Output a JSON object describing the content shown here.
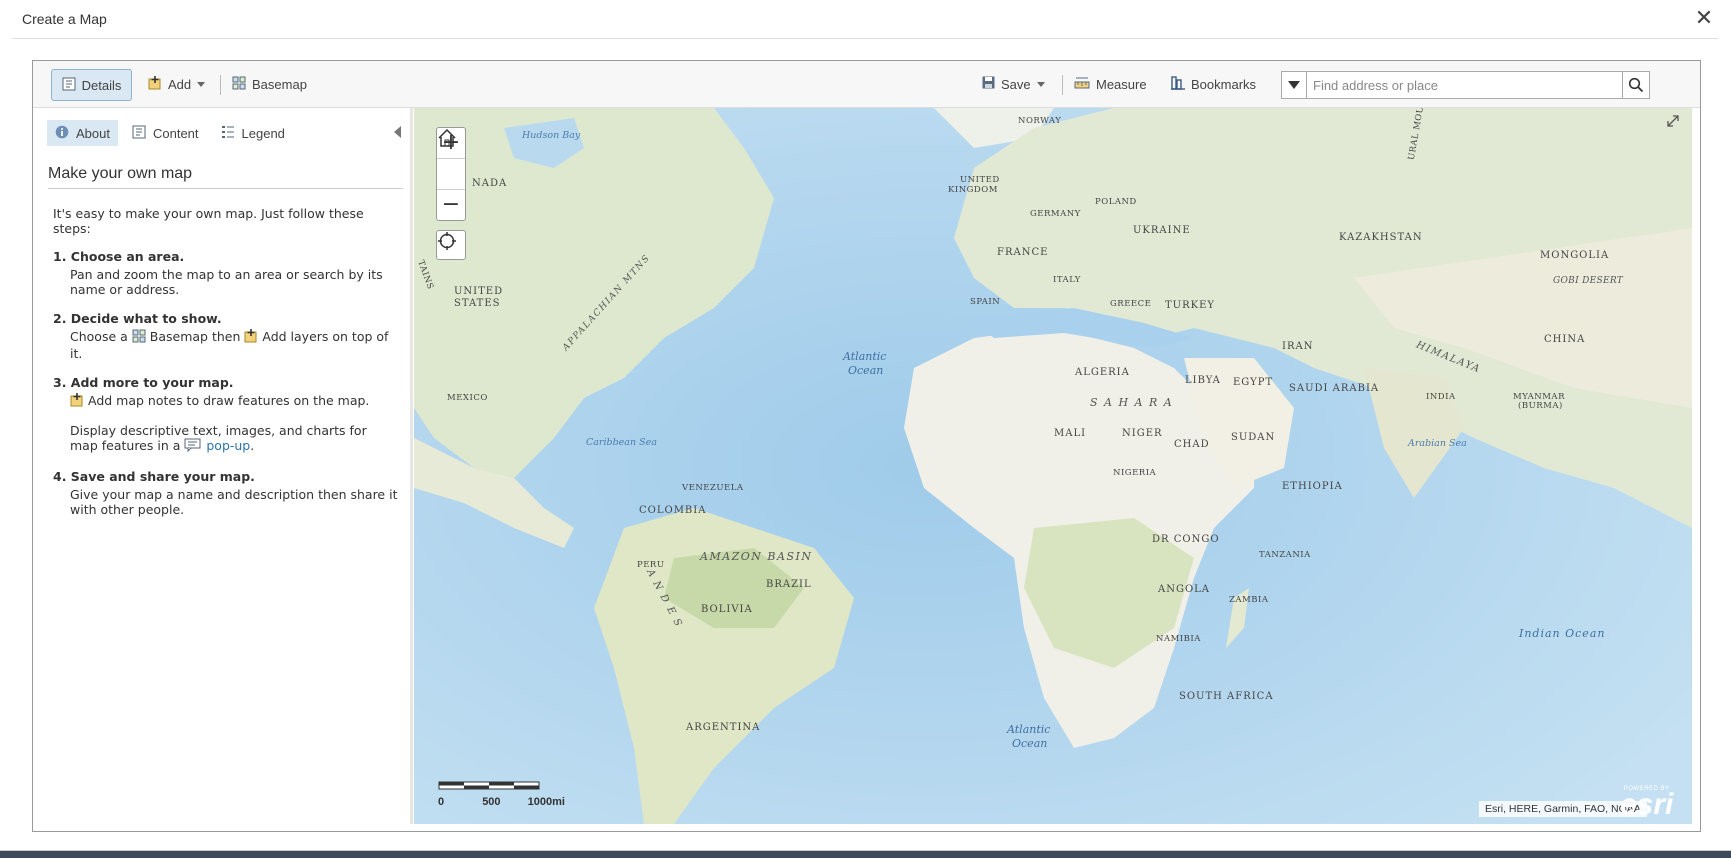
{
  "dialog": {
    "title": "Create a Map",
    "close_glyph": "✕"
  },
  "toolbar": {
    "details_label": "Details",
    "add_label": "Add",
    "basemap_label": "Basemap",
    "save_label": "Save",
    "measure_label": "Measure",
    "bookmarks_label": "Bookmarks"
  },
  "search": {
    "placeholder": "Find address or place",
    "value": ""
  },
  "sidebar": {
    "tabs": [
      {
        "label": "About",
        "icon": "info-icon",
        "active": true
      },
      {
        "label": "Content",
        "icon": "content-icon",
        "active": false
      },
      {
        "label": "Legend",
        "icon": "legend-icon",
        "active": false
      }
    ],
    "about": {
      "title": "Make your own map",
      "intro": "It's easy to make your own map. Just follow these steps:",
      "steps": [
        {
          "head": "1. Choose an area.",
          "text": "Pan and zoom the map to an area or search by its name or address."
        },
        {
          "head": "2. Decide what to show.",
          "text_a": "Choose a",
          "text_b": "Basemap then",
          "text_c": "Add layers on top of it."
        },
        {
          "head": "3. Add more to your map.",
          "text": "Add map notes to draw features on the map.",
          "text2_a": "Display descriptive text, images, and charts for map features in a",
          "link": "pop-up",
          "text2_end": "."
        },
        {
          "head": "4. Save and share your map.",
          "text": "Give your map a name and description then share it with other people."
        }
      ]
    }
  },
  "map": {
    "zoom_in": "+",
    "zoom_out": "−",
    "scale": {
      "zero": "0",
      "mid": "500",
      "end": "1000mi"
    },
    "attribution": "Esri, HERE, Garmin, FAO, NOAA",
    "logo": {
      "powered": "POWERED BY",
      "brand": "esri"
    },
    "labels": {
      "hudson_bay": "Hudson Bay",
      "canada": "NADA",
      "norway": "NORWAY",
      "uk1": "UNITED",
      "uk2": "KINGDOM",
      "poland": "POLAND",
      "germany": "GERMANY",
      "ukraine": "UKRAINE",
      "kazakhstan": "KAZAKHSTAN",
      "mongolia": "MONGOLIA",
      "gobi": "GOBI DESERT",
      "france": "FRANCE",
      "italy": "ITALY",
      "spain": "SPAIN",
      "greece": "GREECE",
      "turkey": "TURKEY",
      "iran": "IRAN",
      "china": "CHINA",
      "himalaya": "HIMALAYA",
      "india": "INDIA",
      "myanmar1": "MYANMAR",
      "myanmar2": "(BURMA)",
      "us1": "UNITED",
      "us2": "STATES",
      "appalachian": "APPALACHIAN MTNS",
      "rockies": "TAINS",
      "atlantic_n1": "Atlantic",
      "atlantic_n2": "Ocean",
      "mexico": "MEXICO",
      "caribbean": "Caribbean Sea",
      "algeria": "ALGERIA",
      "libya": "LIBYA",
      "egypt": "EGYPT",
      "saudi": "SAUDI ARABIA",
      "sahara": "S A H A R A",
      "mali": "MALI",
      "niger": "NIGER",
      "chad": "CHAD",
      "sudan": "SUDAN",
      "arabian_sea": "Arabian Sea",
      "nigeria": "NIGERIA",
      "ethiopia": "ETHIOPIA",
      "venezuela": "VENEZUELA",
      "colombia": "COLOMBIA",
      "amazon": "AMAZON BASIN",
      "brazil": "BRAZIL",
      "peru": "PERU",
      "andes": "A N D E S",
      "bolivia": "BOLIVIA",
      "dr_congo": "DR CONGO",
      "tanzania": "TANZANIA",
      "angola": "ANGOLA",
      "zambia": "ZAMBIA",
      "namibia": "NAMIBIA",
      "indian_ocean": "Indian Ocean",
      "south_africa": "SOUTH AFRICA",
      "argentina": "ARGENTINA",
      "atlantic_s1": "Atlantic",
      "atlantic_s2": "Ocean",
      "ural": "URAL MOU"
    }
  }
}
